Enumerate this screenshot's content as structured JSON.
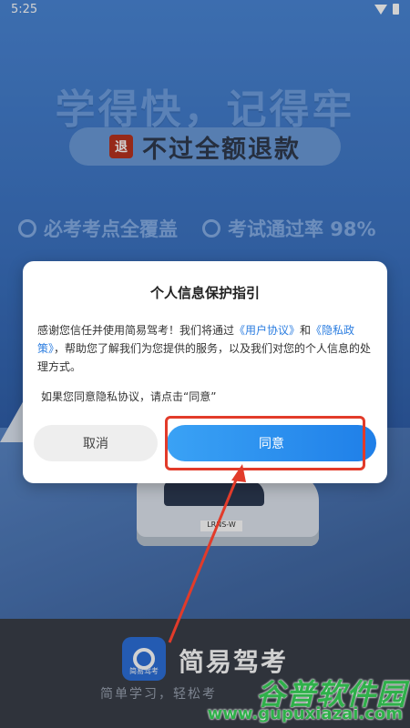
{
  "status_bar": {
    "time": "5:25"
  },
  "background": {
    "headline": "学得快，记得牢",
    "refund_badge": "退",
    "refund_text": "不过全额退款",
    "feature_1": "必考考点全覆盖",
    "feature_2": "考试通过率 98%",
    "plate": "LRNS-W"
  },
  "dialog": {
    "title": "个人信息保护指引",
    "body_prefix": "感谢您信任并使用简易驾考！我们将通过",
    "user_agreement_link": "《用户协议》",
    "and_text": "和",
    "privacy_link": "《隐私政策》",
    "body_suffix": "，帮助您了解我们为您提供的服务，以及我们对您的个人信息的处理方式。",
    "hint": "如果您同意隐私协议，请点击“同意”",
    "cancel_label": "取消",
    "agree_label": "同意"
  },
  "app": {
    "name": "简易驾考",
    "slogan": "简单学习，轻松考",
    "logo_caption": "简易驾考"
  },
  "watermark": {
    "brand": "谷普软件园",
    "url": "www.gupuxiazai.com"
  },
  "colors": {
    "accent": "#1f7fe8",
    "link": "#2b7de0",
    "highlight": "#e23b2a"
  }
}
